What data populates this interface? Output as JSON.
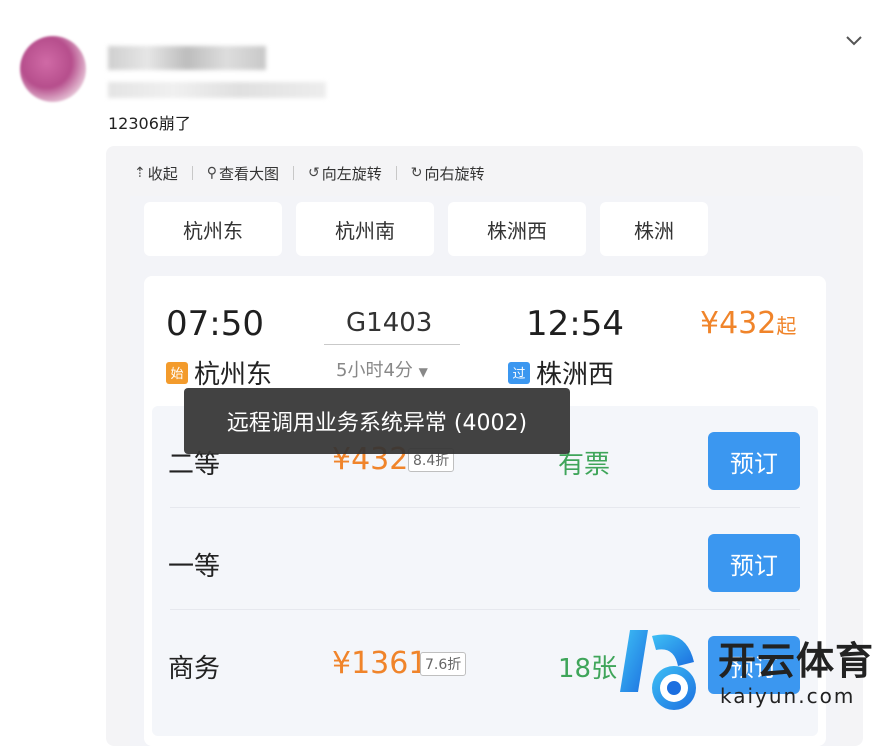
{
  "post": {
    "text": "12306崩了"
  },
  "viewer": {
    "toolbar": [
      {
        "icon": "upload-arrow-icon",
        "glyph": "⇡",
        "label": "收起"
      },
      {
        "icon": "magnifier-icon",
        "glyph": "⚲",
        "label": "查看大图"
      },
      {
        "icon": "rotate-left-icon",
        "glyph": "↺",
        "label": "向左旋转"
      },
      {
        "icon": "rotate-right-icon",
        "glyph": "↻",
        "label": "向右旋转"
      }
    ]
  },
  "screenshot": {
    "stations": [
      "杭州东",
      "杭州南",
      "株洲西",
      "株洲"
    ],
    "train": {
      "departure_time": "07:50",
      "train_number": "G1403",
      "duration": "5小时4分",
      "arrival_time": "12:54",
      "price_from": "¥432",
      "price_suffix": "起",
      "departure_tag": "始",
      "departure_station": "杭州东",
      "arrival_tag": "过",
      "arrival_station": "株洲西"
    },
    "seats": [
      {
        "name": "二等",
        "price": "¥432",
        "discount": "8.4折",
        "availability": "有票",
        "button": "预订"
      },
      {
        "name": "一等",
        "price": "",
        "discount": "",
        "availability": "",
        "button": "预订"
      },
      {
        "name": "商务",
        "price": "¥1361",
        "discount": "7.6折",
        "availability": "18张",
        "button": "预订"
      }
    ],
    "toast": "远程调用业务系统异常 (4002)"
  },
  "watermark": {
    "brand": "开云体育",
    "domain": "kaiyun.com"
  },
  "colors": {
    "price": "#f0842a",
    "available": "#3fa55a",
    "button": "#3b97f0",
    "tag_start": "#f39b2c",
    "tag_pass": "#3b97f0"
  }
}
